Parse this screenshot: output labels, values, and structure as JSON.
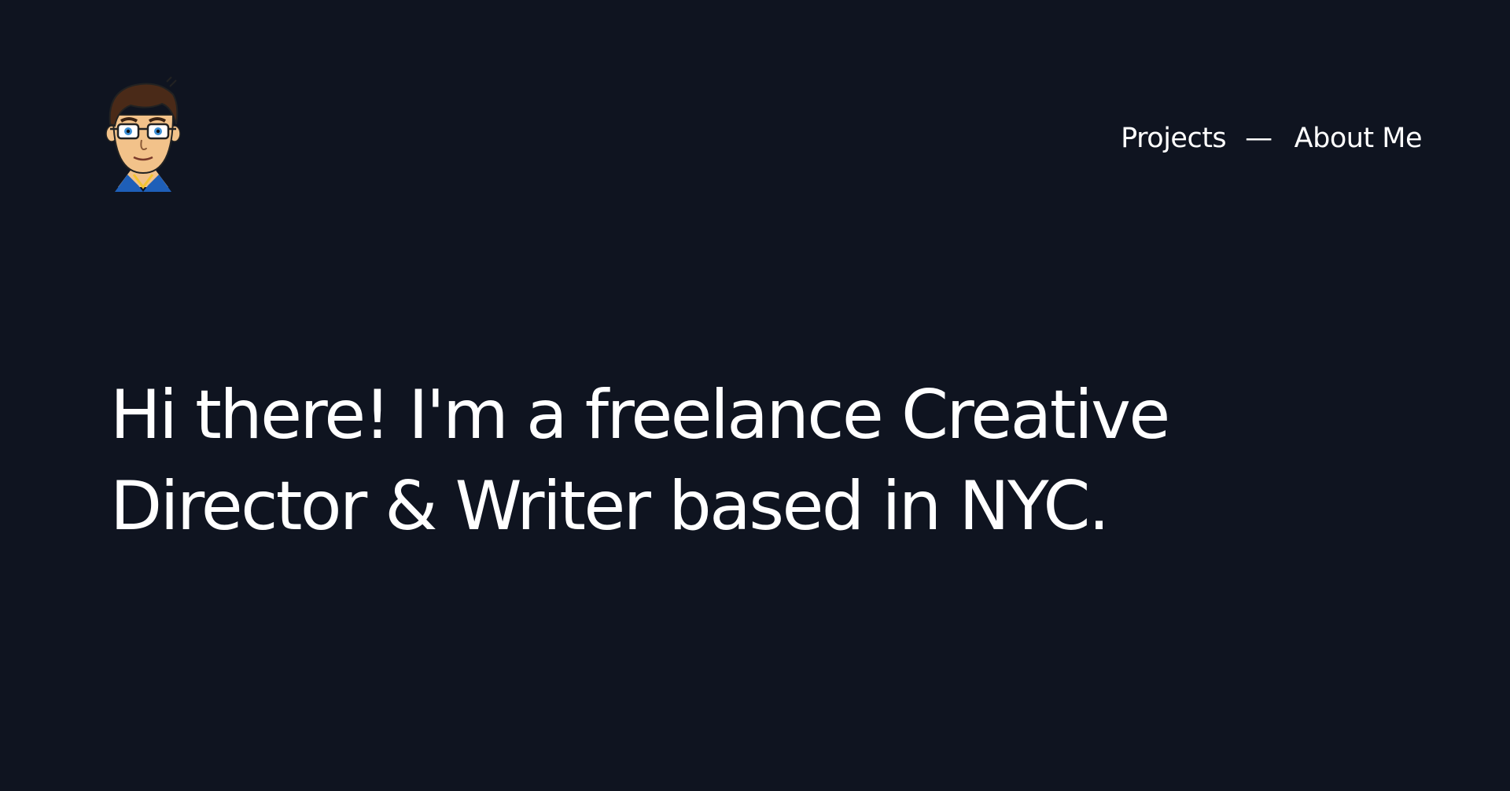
{
  "header": {
    "avatar_icon": "cartoon-avatar-with-glasses",
    "nav": {
      "projects_label": "Projects",
      "separator": "—",
      "about_label": "About Me"
    }
  },
  "hero": {
    "heading": "Hi there! I'm a freelance Creative Director & Writer based in NYC."
  },
  "colors": {
    "background": "#0f1420",
    "text": "#ffffff"
  }
}
